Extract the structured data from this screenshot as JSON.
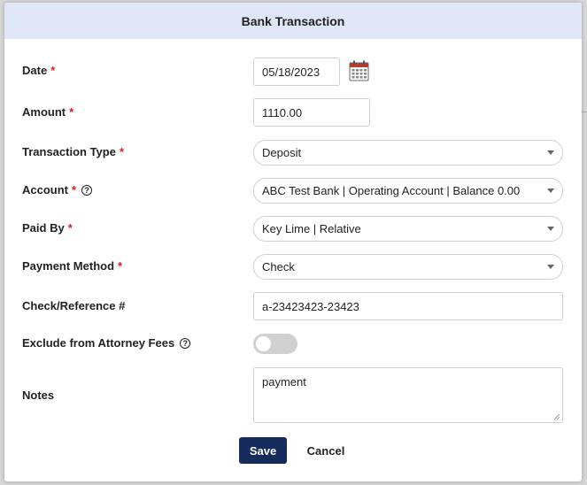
{
  "dialog": {
    "title": "Bank Transaction",
    "required_mark": "*",
    "help_glyph": "?"
  },
  "fields": {
    "date": {
      "label": "Date",
      "value": "05/18/2023",
      "icon": "calendar-icon"
    },
    "amount": {
      "label": "Amount",
      "value": "1110.00"
    },
    "transaction_type": {
      "label": "Transaction Type",
      "value": "Deposit"
    },
    "account": {
      "label": "Account",
      "value": "ABC Test Bank | Operating Account | Balance 0.00",
      "help_icon": "question-circle-icon"
    },
    "paid_by": {
      "label": "Paid By",
      "value": "Key Lime | Relative"
    },
    "payment_method": {
      "label": "Payment Method",
      "value": "Check"
    },
    "check_reference": {
      "label": "Check/Reference #",
      "value": "a-23423423-23423"
    },
    "exclude_fees": {
      "label": "Exclude from Attorney Fees",
      "checked": false,
      "help_icon": "question-circle-icon"
    },
    "notes": {
      "label": "Notes",
      "value": "payment"
    }
  },
  "buttons": {
    "save": "Save",
    "cancel": "Cancel"
  },
  "colors": {
    "header_bg": "#dfe6f8",
    "required": "#d0231b",
    "primary_button": "#142b5c",
    "toggle_off": "#d0d0d0"
  }
}
